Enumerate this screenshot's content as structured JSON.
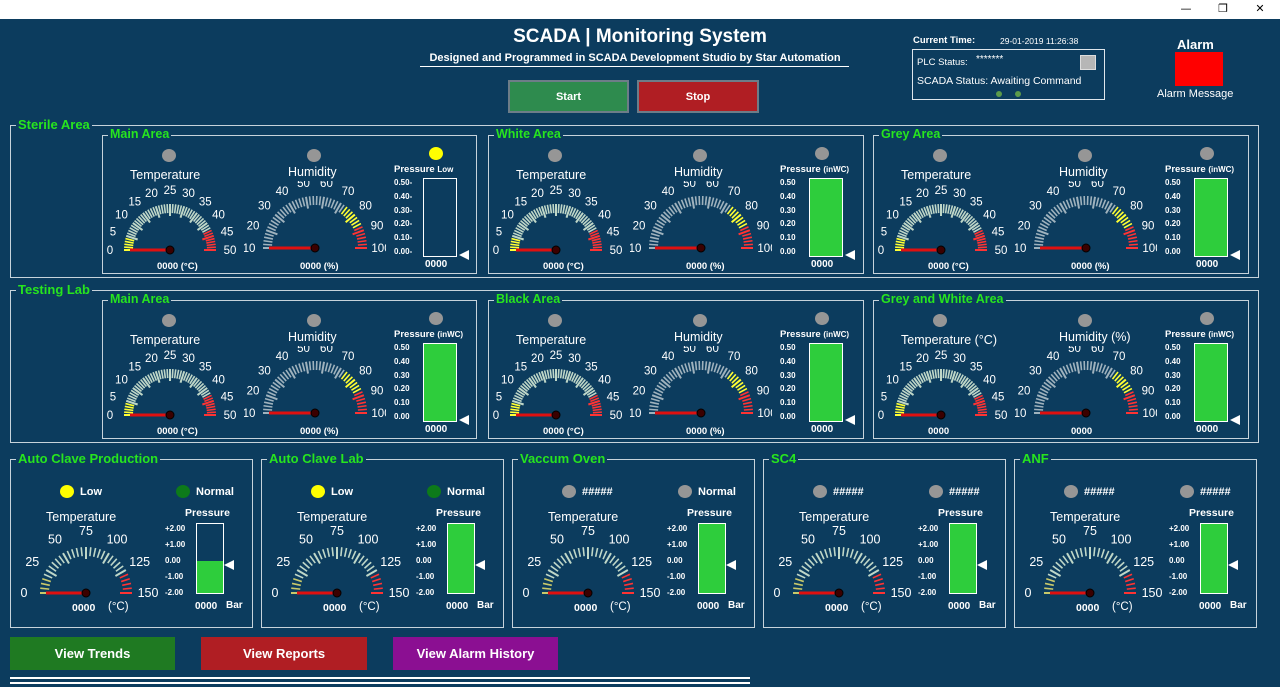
{
  "window": {
    "minimize": "—",
    "maximize": "❐",
    "close": "✕"
  },
  "header": {
    "title": "SCADA |  Monitoring System",
    "subtitle": "Designed and Programmed in SCADA Development Studio by Star Automation",
    "start_label": "Start",
    "stop_label": "Stop"
  },
  "status": {
    "current_time_label": "Current Time:",
    "current_time": "29-01-2019 11:26:38",
    "plc_label": "PLC Status:",
    "plc_value": "*******",
    "scada_label": "SCADA Status:",
    "scada_value": "Awaiting Command"
  },
  "alarm": {
    "label": "Alarm",
    "message": "Alarm Message",
    "color": "#ff0000"
  },
  "sections": [
    "Sterile Area",
    "Testing Lab"
  ],
  "areas": [
    {
      "name": "Main Area",
      "temp_label": "Temperature",
      "temp_value": "0000 (°C)",
      "hum_label": "Humidity",
      "hum_value": "0000 (%)",
      "pres_label": "Pressure",
      "pres_unit": "Low",
      "pres_value": "0000",
      "pres_fill": 0,
      "temp_dot": "gray",
      "hum_dot": "gray",
      "pres_dot": "yellow",
      "scale": [
        "0.50-",
        "0.40-",
        "0.30-",
        "0.20-",
        "0.10-",
        "0.00-"
      ]
    },
    {
      "name": "White Area",
      "temp_label": "Temperature",
      "temp_value": "0000 (°C)",
      "hum_label": "Humidity",
      "hum_value": "0000 (%)",
      "pres_label": "Pressure",
      "pres_unit": "(inWC)",
      "pres_value": "0000",
      "pres_fill": 100,
      "temp_dot": "gray",
      "hum_dot": "gray",
      "pres_dot": "gray",
      "scale": [
        "0.50",
        "0.40",
        "0.30",
        "0.20",
        "0.10",
        "0.00"
      ]
    },
    {
      "name": "Grey Area",
      "temp_label": "Temperature",
      "temp_value": "0000 (°C)",
      "hum_label": "Humidity",
      "hum_value": "0000 (%)",
      "pres_label": "Pressure",
      "pres_unit": "(inWC)",
      "pres_value": "0000",
      "pres_fill": 100,
      "temp_dot": "gray",
      "hum_dot": "gray",
      "pres_dot": "gray",
      "scale": [
        "0.50",
        "0.40",
        "0.30",
        "0.20",
        "0.10",
        "0.00"
      ]
    },
    {
      "name": "Main Area",
      "temp_label": "Temperature",
      "temp_value": "0000 (°C)",
      "hum_label": "Humidity",
      "hum_value": "0000 (%)",
      "pres_label": "Pressure",
      "pres_unit": "(inWC)",
      "pres_value": "0000",
      "pres_fill": 100,
      "temp_dot": "gray",
      "hum_dot": "gray",
      "pres_dot": "gray",
      "scale": [
        "0.50",
        "0.40",
        "0.30",
        "0.20",
        "0.10",
        "0.00"
      ]
    },
    {
      "name": "Black Area",
      "temp_label": "Temperature",
      "temp_value": "0000 (°C)",
      "hum_label": "Humidity",
      "hum_value": "0000 (%)",
      "pres_label": "Pressure",
      "pres_unit": "(inWC)",
      "pres_value": "0000",
      "pres_fill": 100,
      "temp_dot": "gray",
      "hum_dot": "gray",
      "pres_dot": "gray",
      "scale": [
        "0.50",
        "0.40",
        "0.30",
        "0.20",
        "0.10",
        "0.00"
      ]
    },
    {
      "name": "Grey and White Area",
      "temp_label": "Temperature (°C)",
      "temp_value": "0000",
      "hum_label": "Humidity (%)",
      "hum_value": "0000",
      "pres_label": "Pressure",
      "pres_unit": "(inWC)",
      "pres_value": "0000",
      "pres_fill": 100,
      "temp_dot": "gray",
      "hum_dot": "gray",
      "pres_dot": "gray",
      "scale": [
        "0.50",
        "0.40",
        "0.30",
        "0.20",
        "0.10",
        "0.00"
      ]
    }
  ],
  "temp_scale": [
    "0",
    "5",
    "10",
    "15",
    "20",
    "25",
    "30",
    "35",
    "40",
    "45",
    "50"
  ],
  "hum_scale": [
    "10",
    "20",
    "30",
    "40",
    "50",
    "60",
    "70",
    "80",
    "90",
    "100"
  ],
  "machines": [
    {
      "name": "Auto Clave Production",
      "left_status": "Low",
      "left_dot": "yellow",
      "right_status": "Normal",
      "right_dot": "green",
      "temp_label": "Temperature",
      "temp_value": "0000",
      "temp_unit": "(°C)",
      "pres_label": "Pressure",
      "pres_value": "0000",
      "pres_unit": "Bar",
      "pres_fill": 47
    },
    {
      "name": "Auto Clave Lab",
      "left_status": "Low",
      "left_dot": "yellow",
      "right_status": "Normal",
      "right_dot": "green",
      "temp_label": "Temperature",
      "temp_value": "0000",
      "temp_unit": "(°C)",
      "pres_label": "Pressure",
      "pres_value": "0000",
      "pres_unit": "Bar",
      "pres_fill": 100
    },
    {
      "name": "Vaccum Oven",
      "left_status": "#####",
      "left_dot": "gray",
      "right_status": "Normal",
      "right_dot": "gray",
      "temp_label": "Temperature",
      "temp_value": "0000",
      "temp_unit": "(°C)",
      "pres_label": "Pressure",
      "pres_value": "0000",
      "pres_unit": "Bar",
      "pres_fill": 100
    },
    {
      "name": "SC4",
      "left_status": "#####",
      "left_dot": "gray",
      "right_status": "#####",
      "right_dot": "gray",
      "temp_label": "Temperature",
      "temp_value": "0000",
      "temp_unit": "(°C)",
      "pres_label": "Pressure",
      "pres_value": "0000",
      "pres_unit": "Bar",
      "pres_fill": 100
    },
    {
      "name": "ANF",
      "left_status": "#####",
      "left_dot": "gray",
      "right_status": "#####",
      "right_dot": "gray",
      "temp_label": "Temperature",
      "temp_value": "0000",
      "temp_unit": "(°C)",
      "pres_label": "Pressure",
      "pres_value": "0000",
      "pres_unit": "Bar",
      "pres_fill": 100
    }
  ],
  "machine_temp_scale": [
    "0",
    "25",
    "50",
    "75",
    "100",
    "125",
    "150"
  ],
  "machine_pres_scale": [
    "+2.00",
    "+1.00",
    "0.00",
    "-1.00",
    "-2.00"
  ],
  "nav": [
    {
      "label": "View Trends",
      "color": "#1f7a22"
    },
    {
      "label": "View Reports",
      "color": "#b01e23"
    },
    {
      "label": "View Alarm History",
      "color": "#8b0f92"
    }
  ]
}
